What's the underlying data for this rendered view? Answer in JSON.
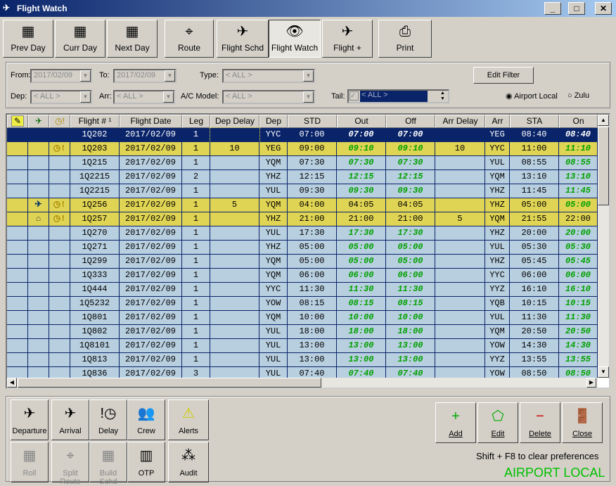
{
  "window": {
    "title": "Flight Watch",
    "min": "_",
    "max": "□",
    "close": "✕"
  },
  "toolbar": [
    {
      "label": "Prev Day",
      "icon": "calendar-prev-icon"
    },
    {
      "label": "Curr Day",
      "icon": "calendar-icon"
    },
    {
      "label": "Next Day",
      "icon": "calendar-next-icon"
    },
    {
      "label": "Route",
      "icon": "route-icon"
    },
    {
      "label": "Flight Schd",
      "icon": "schedule-icon"
    },
    {
      "label": "Flight Watch",
      "icon": "eye-icon",
      "active": true
    },
    {
      "label": "Flight  +",
      "icon": "flight-add-icon"
    },
    {
      "label": "Print",
      "icon": "printer-icon"
    }
  ],
  "filter": {
    "from_label": "From:",
    "from": "2017/02/09",
    "to_label": "To:",
    "to": "2017/02/09",
    "type_label": "Type:",
    "type": "< ALL >",
    "dep_label": "Dep:",
    "dep": "< ALL >",
    "arr_label": "Arr:",
    "arr": "< ALL >",
    "model_label": "A/C Model:",
    "model": "< ALL >",
    "tail_label": "Tail:",
    "tail": "< ALL >",
    "edit_filter": "Edit Filter",
    "airport_local": "Airport Local",
    "zulu": "Zulu",
    "time_mode": "airport_local"
  },
  "grid": {
    "columns": [
      "",
      "",
      "",
      "Flight # ¹",
      "Flight Date",
      "Leg",
      "Dep Delay",
      "Dep",
      "STD",
      "Out",
      "Off",
      "Arr Delay",
      "Arr",
      "STA",
      "On"
    ],
    "rows": [
      [
        "",
        "",
        "",
        "1Q202",
        "2017/02/09",
        "1",
        "",
        "YYC",
        "07:00",
        "07:00",
        "07:00",
        "",
        "YEG",
        "08:40",
        "08:40",
        "sel",
        "ggg"
      ],
      [
        "",
        "",
        "delay",
        "1Q203",
        "2017/02/09",
        "1",
        "10",
        "YEG",
        "09:00",
        "09:10",
        "09:10",
        "10",
        "YYC",
        "11:00",
        "11:10",
        "yel",
        "ggg"
      ],
      [
        "",
        "",
        "",
        "1Q215",
        "2017/02/09",
        "1",
        "",
        "YQM",
        "07:30",
        "07:30",
        "07:30",
        "",
        "YUL",
        "08:55",
        "08:55",
        "",
        "ggg"
      ],
      [
        "",
        "",
        "",
        "1Q2215",
        "2017/02/09",
        "2",
        "",
        "YHZ",
        "12:15",
        "12:15",
        "12:15",
        "",
        "YQM",
        "13:10",
        "13:10",
        "",
        "ggg"
      ],
      [
        "",
        "",
        "",
        "1Q2215",
        "2017/02/09",
        "1",
        "",
        "YUL",
        "09:30",
        "09:30",
        "09:30",
        "",
        "YHZ",
        "11:45",
        "11:45",
        "",
        "ggg"
      ],
      [
        "",
        "departed",
        "delay",
        "1Q256",
        "2017/02/09",
        "1",
        "5",
        "YQM",
        "04:00",
        "04:05",
        "04:05",
        "",
        "YHZ",
        "05:00",
        "05:00",
        "yel",
        "nng"
      ],
      [
        "",
        "hangar",
        "delay",
        "1Q257",
        "2017/02/09",
        "1",
        "",
        "YHZ",
        "21:00",
        "21:00",
        "21:00",
        "5",
        "YQM",
        "21:55",
        "22:00",
        "yel",
        "nnn"
      ],
      [
        "",
        "",
        "",
        "1Q270",
        "2017/02/09",
        "1",
        "",
        "YUL",
        "17:30",
        "17:30",
        "17:30",
        "",
        "YHZ",
        "20:00",
        "20:00",
        "",
        "ggg"
      ],
      [
        "",
        "",
        "",
        "1Q271",
        "2017/02/09",
        "1",
        "",
        "YHZ",
        "05:00",
        "05:00",
        "05:00",
        "",
        "YUL",
        "05:30",
        "05:30",
        "",
        "ggg"
      ],
      [
        "",
        "",
        "",
        "1Q299",
        "2017/02/09",
        "1",
        "",
        "YQM",
        "05:00",
        "05:00",
        "05:00",
        "",
        "YHZ",
        "05:45",
        "05:45",
        "",
        "ggg"
      ],
      [
        "",
        "",
        "",
        "1Q333",
        "2017/02/09",
        "1",
        "",
        "YQM",
        "06:00",
        "06:00",
        "06:00",
        "",
        "YYC",
        "06:00",
        "06:00",
        "",
        "ggg"
      ],
      [
        "",
        "",
        "",
        "1Q444",
        "2017/02/09",
        "1",
        "",
        "YYC",
        "11:30",
        "11:30",
        "11:30",
        "",
        "YYZ",
        "16:10",
        "16:10",
        "",
        "ggg"
      ],
      [
        "",
        "",
        "",
        "1Q5232",
        "2017/02/09",
        "1",
        "",
        "YOW",
        "08:15",
        "08:15",
        "08:15",
        "",
        "YQB",
        "10:15",
        "10:15",
        "",
        "ggg"
      ],
      [
        "",
        "",
        "",
        "1Q801",
        "2017/02/09",
        "1",
        "",
        "YQM",
        "10:00",
        "10:00",
        "10:00",
        "",
        "YUL",
        "11:30",
        "11:30",
        "",
        "ggg"
      ],
      [
        "",
        "",
        "",
        "1Q802",
        "2017/02/09",
        "1",
        "",
        "YUL",
        "18:00",
        "18:00",
        "18:00",
        "",
        "YQM",
        "20:50",
        "20:50",
        "",
        "ggg"
      ],
      [
        "",
        "",
        "",
        "1Q8101",
        "2017/02/09",
        "1",
        "",
        "YUL",
        "13:00",
        "13:00",
        "13:00",
        "",
        "YOW",
        "14:30",
        "14:30",
        "",
        "ggg"
      ],
      [
        "",
        "",
        "",
        "1Q813",
        "2017/02/09",
        "1",
        "",
        "YUL",
        "13:00",
        "13:00",
        "13:00",
        "",
        "YYZ",
        "13:55",
        "13:55",
        "",
        "ggg"
      ],
      [
        "",
        "",
        "",
        "1Q836",
        "2017/02/09",
        "3",
        "",
        "YUL",
        "07:40",
        "07:40",
        "07:40",
        "",
        "YOW",
        "08:50",
        "08:50",
        "",
        "ggg"
      ]
    ]
  },
  "colors": {
    "row": "#b8cfe0",
    "delayed": "#e0d454",
    "selected": "#0a246a",
    "actual_time": "#00a000",
    "mode_text": "#00c000"
  },
  "actions": [
    {
      "label": "Departure",
      "icon": "departure-icon"
    },
    {
      "label": "Arrival",
      "icon": "arrival-icon"
    },
    {
      "label": "Delay",
      "icon": "delay-icon"
    },
    {
      "label": "Crew",
      "icon": "crew-icon"
    },
    {
      "label": "Alerts",
      "icon": "alert-icon"
    },
    {
      "label": "Roll",
      "icon": "roll-icon",
      "disabled": true
    },
    {
      "label": "Split Route",
      "icon": "split-route-icon",
      "disabled": true
    },
    {
      "label": "Build Schd",
      "icon": "build-schedule-icon",
      "disabled": true
    },
    {
      "label": "OTP",
      "icon": "otp-chart-icon"
    },
    {
      "label": "Audit",
      "icon": "audit-icon"
    }
  ],
  "record": [
    {
      "label": "Add",
      "icon": "add-icon"
    },
    {
      "label": "Edit",
      "icon": "edit-icon"
    },
    {
      "label": "Delete",
      "icon": "delete-icon"
    },
    {
      "label": "Close",
      "icon": "door-icon"
    }
  ],
  "hint": "Shift + F8 to clear preferences",
  "mode": "AIRPORT LOCAL"
}
